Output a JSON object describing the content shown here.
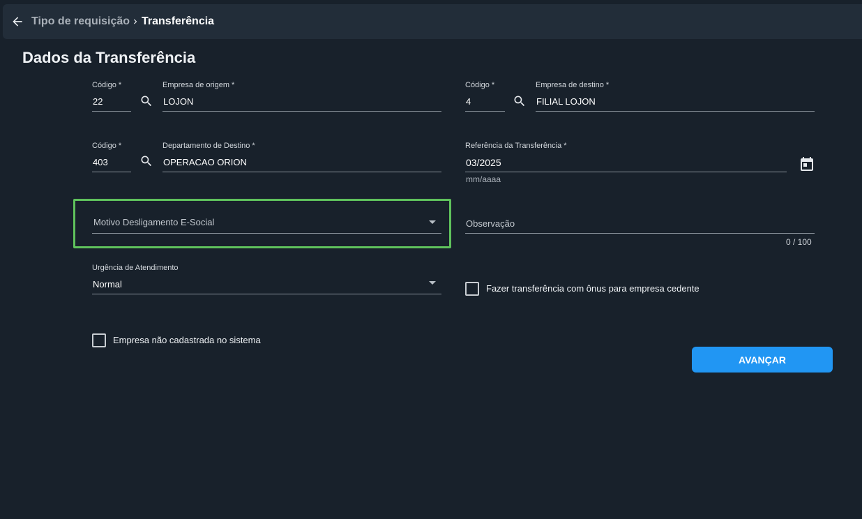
{
  "breadcrumb": {
    "back_icon": "arrow-left-icon",
    "parent": "Tipo de requisição",
    "separator_icon": "chevron-right-icon",
    "current": "Transferência"
  },
  "page": {
    "title": "Dados da Transferência"
  },
  "origin": {
    "code_label": "Código *",
    "code_value": "22",
    "company_label": "Empresa de origem *",
    "company_value": "LOJON"
  },
  "destination": {
    "code_label": "Código *",
    "code_value": "4",
    "company_label": "Empresa de destino *",
    "company_value": "FILIAL LOJON"
  },
  "department": {
    "code_label": "Código *",
    "code_value": "403",
    "name_label": "Departamento de Destino *",
    "name_value": "OPERACAO ORION"
  },
  "reference": {
    "label": "Referência da Transferência *",
    "value": "03/2025",
    "hint": "mm/aaaa",
    "icon": "calendar-icon"
  },
  "motivo": {
    "placeholder": "Motivo Desligamento E-Social"
  },
  "observacao": {
    "placeholder": "Observação",
    "counter": "0 / 100"
  },
  "urgencia": {
    "label": "Urgência de Atendimento",
    "value": "Normal"
  },
  "checkboxes": {
    "onus": {
      "label": "Fazer transferência com ônus para empresa cedente",
      "checked": false
    },
    "nao_cadastrada": {
      "label": "Empresa não cadastrada no sistema",
      "checked": false
    }
  },
  "actions": {
    "next_label": "AVANÇAR"
  },
  "colors": {
    "background": "#18212b",
    "topbar": "#222d39",
    "primary": "#2196f3",
    "highlight": "#5fc25c"
  }
}
